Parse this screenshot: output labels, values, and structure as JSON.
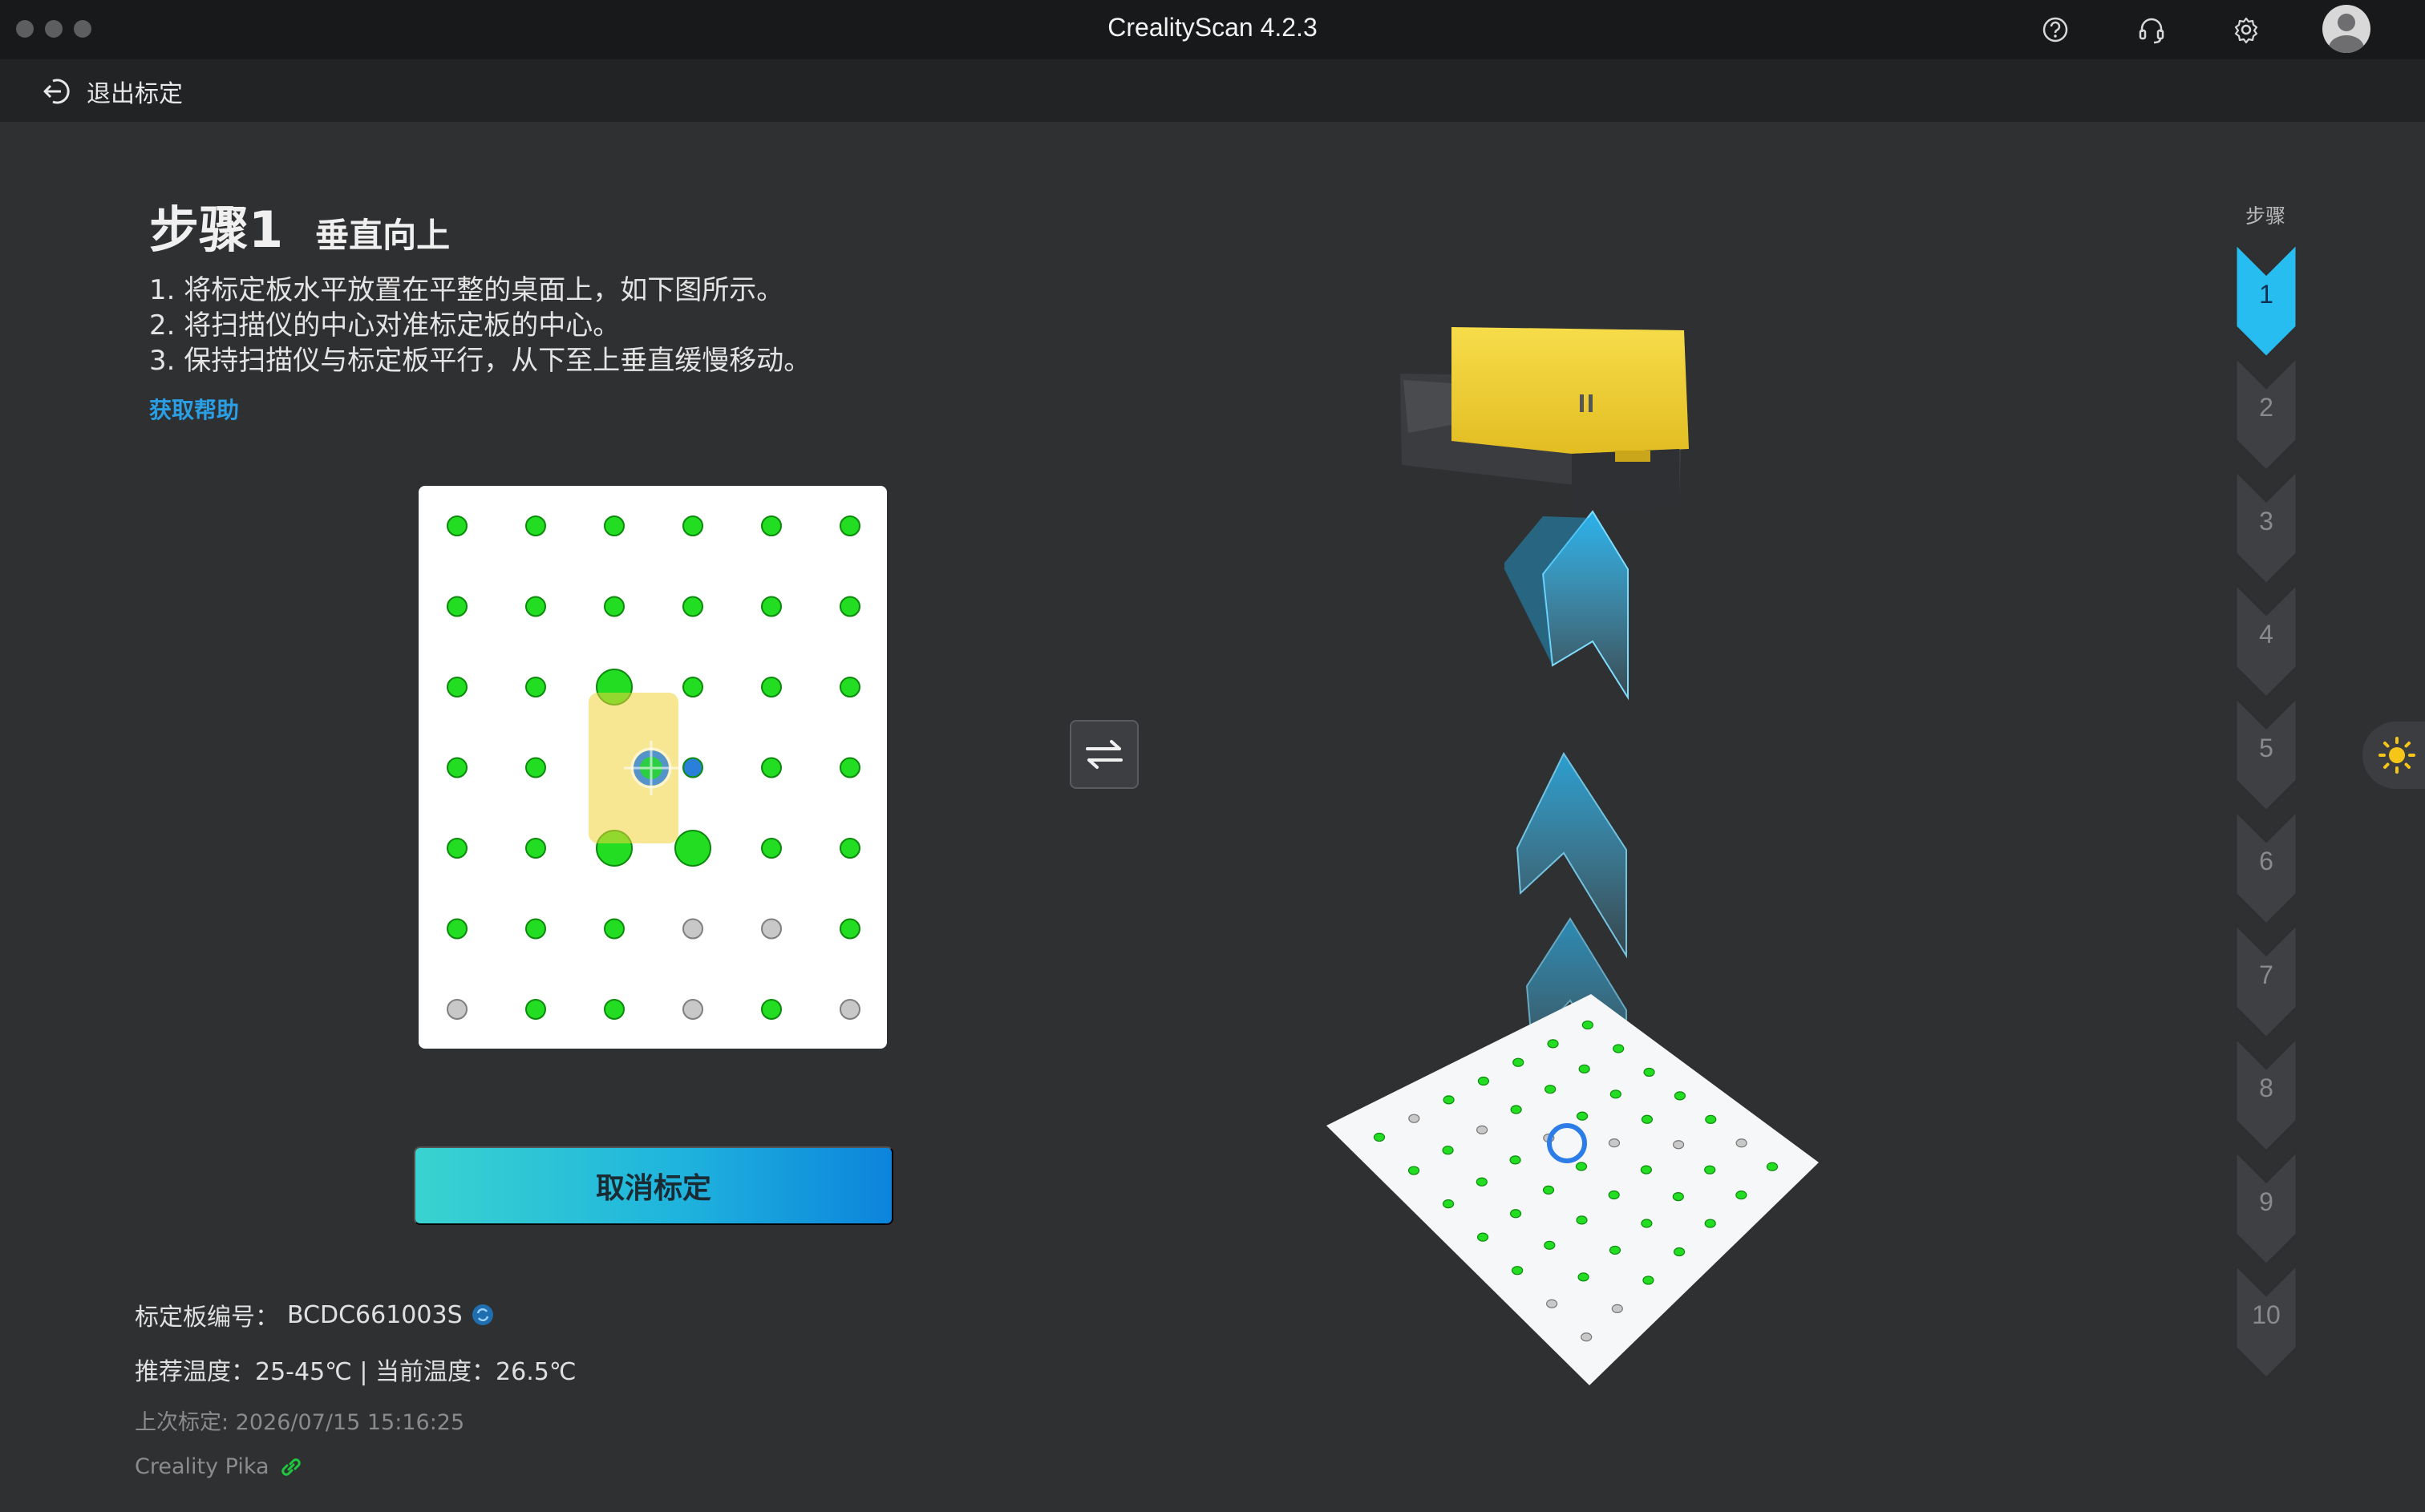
{
  "window": {
    "title": "CrealityScan 4.2.3"
  },
  "toolbar": {
    "icons": [
      "help-icon",
      "headset-icon",
      "gear-icon",
      "avatar"
    ]
  },
  "header": {
    "exit_label": "退出标定",
    "exit_icon": "exit-icon"
  },
  "step": {
    "number": "步骤1",
    "subtitle": "垂直向上",
    "instructions": [
      "1. 将标定板水平放置在平整的桌面上，如下图所示。",
      "2. 将扫描仪的中心对准标定板的中心。",
      "3. 保持扫描仪与标定板平行，从下至上垂直缓慢移动。"
    ],
    "help_link": "获取帮助"
  },
  "board": {
    "dot_states": [
      [
        "green",
        "green",
        "green",
        "green",
        "green",
        "green"
      ],
      [
        "green",
        "green",
        "green",
        "green",
        "green",
        "green"
      ],
      [
        "green",
        "green",
        "green-big",
        "green",
        "green",
        "green"
      ],
      [
        "green",
        "green",
        "scanner",
        "blue",
        "green",
        "green"
      ],
      [
        "green",
        "green",
        "green-big",
        "green-big",
        "green",
        "green"
      ],
      [
        "green",
        "green",
        "green",
        "gray",
        "gray",
        "green"
      ],
      [
        "gray",
        "green",
        "green",
        "gray",
        "green",
        "gray"
      ]
    ]
  },
  "cancel_button": "取消标定",
  "info": {
    "board_id_label": "标定板编号：",
    "board_id_value": "BCDC661003S",
    "temp_text": "推荐温度：25-45℃ | 当前温度：26.5℃",
    "last_calibration": "上次标定: 2026/07/15 15:16:25",
    "device_name": "Creality Pika"
  },
  "rail": {
    "title": "步骤",
    "steps": [
      "1",
      "2",
      "3",
      "4",
      "5",
      "6",
      "7",
      "8",
      "9",
      "10"
    ],
    "active": 1
  },
  "colors": {
    "accent": "#1eb7ea",
    "dot_green": "#22dd22",
    "dot_gray": "#c8c8c8",
    "scanner_yellow": "#f0d33a"
  }
}
